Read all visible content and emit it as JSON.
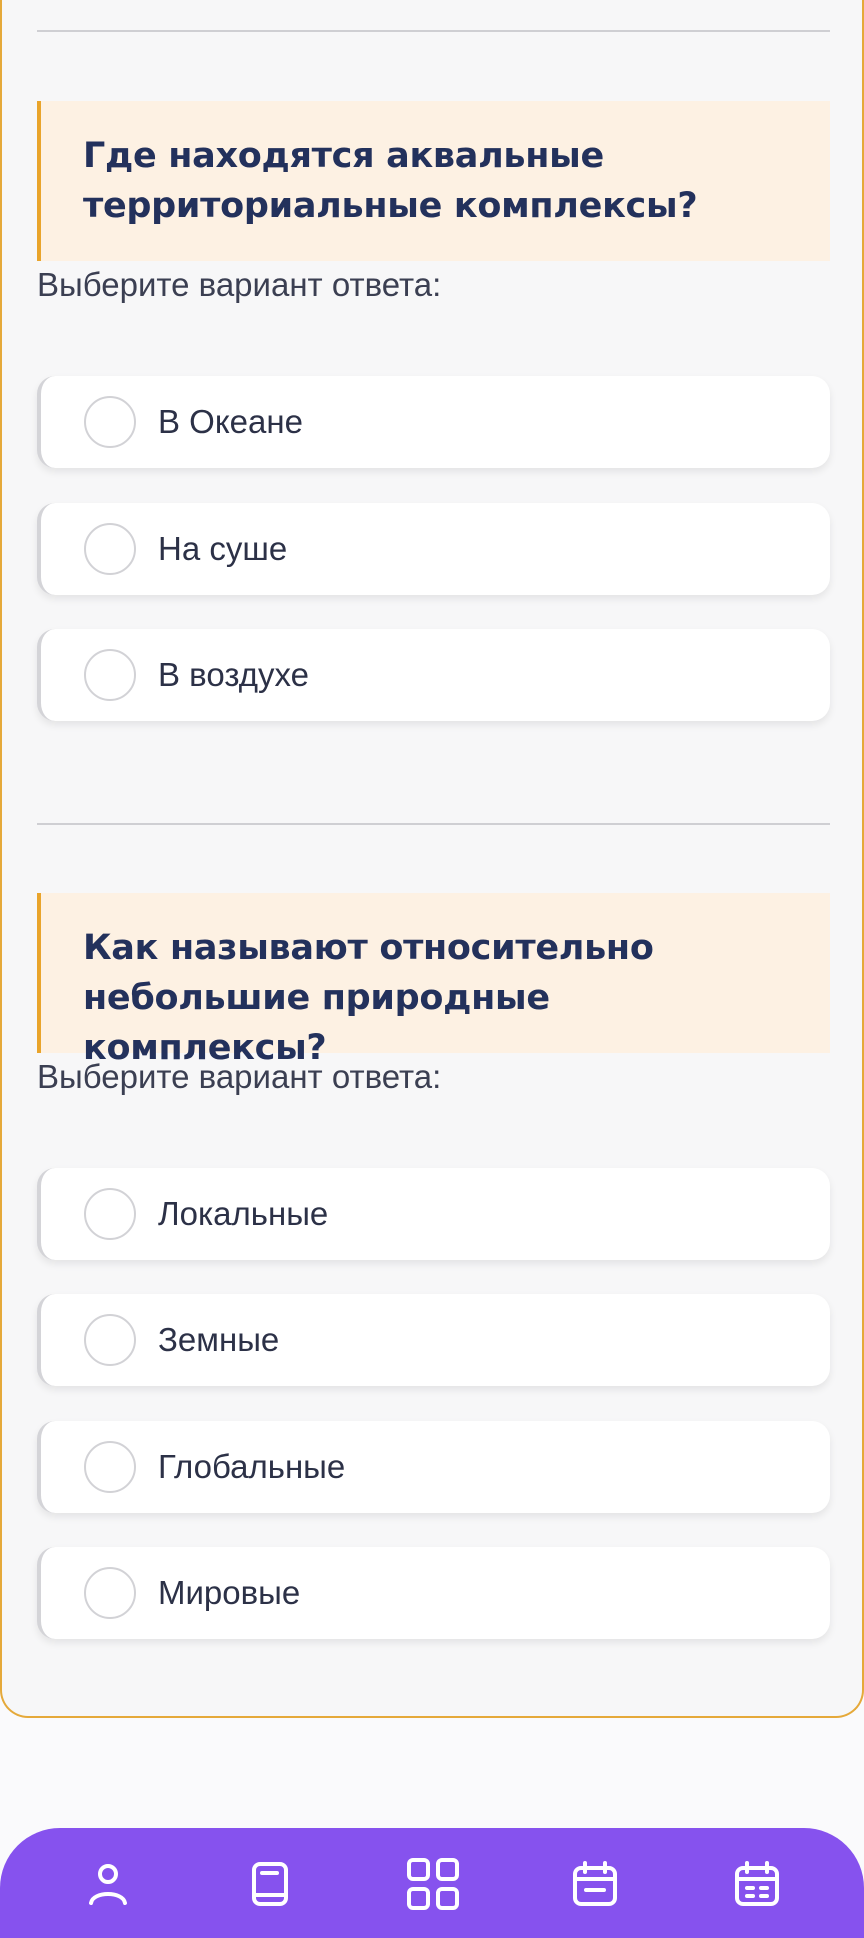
{
  "colors": {
    "accent": "#e9a42b",
    "question_bg": "#fdf1e3",
    "question_text": "#23315c",
    "nav_bg": "#8652ee"
  },
  "questions": [
    {
      "text": "Где находятся аквальные территориальные комплексы?",
      "prompt": "Выберите вариант ответа:",
      "options": [
        "В Океане",
        "На суше",
        "В воздухе"
      ]
    },
    {
      "text": "Как называют относительно небольшие природные комплексы?",
      "prompt": "Выберите вариант ответа:",
      "options": [
        "Локальные",
        "Земные",
        "Глобальные",
        "Мировые"
      ]
    }
  ],
  "bottom_nav": {
    "items": [
      {
        "icon": "user-icon"
      },
      {
        "icon": "book-icon"
      },
      {
        "icon": "grid-icon"
      },
      {
        "icon": "calendar-icon"
      },
      {
        "icon": "calendar-grid-icon"
      }
    ]
  }
}
